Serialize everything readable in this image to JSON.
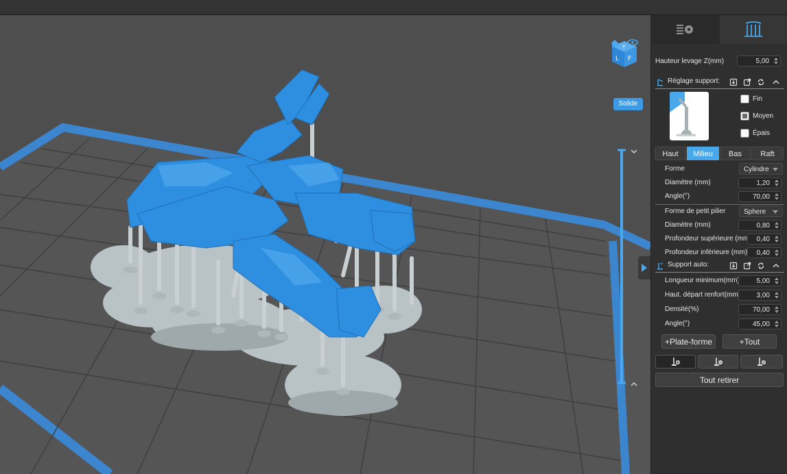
{
  "viewport": {
    "display_mode_label": "Solide"
  },
  "colors": {
    "accent": "#49a8ea",
    "model": "#2e8fe0",
    "support": "#b8c2c4"
  },
  "panel": {
    "lift_height": {
      "label": "Hauteur levage Z(mm)",
      "value": "5,00"
    },
    "support_settings": {
      "title": "Réglage support:",
      "options": [
        {
          "label": "Fin",
          "checked": false
        },
        {
          "label": "Moyen",
          "checked": true
        },
        {
          "label": "Épais",
          "checked": false
        }
      ],
      "tabs": [
        "Haut",
        "Milieu",
        "Bas",
        "Raft"
      ],
      "active_tab": "Milieu",
      "shape": {
        "label": "Forme",
        "value": "Cylindre"
      },
      "diameter": {
        "label": "Diamètre (mm)",
        "value": "1,20"
      },
      "angle": {
        "label": "Angle(°)",
        "value": "70,00"
      },
      "small_pillar_shape": {
        "label": "Forme de petit pilier",
        "value": "Sphere"
      },
      "small_diameter": {
        "label": "Diamètre (mm)",
        "value": "0,80"
      },
      "top_depth": {
        "label": "Profondeur supérieure (mm)",
        "value": "0,40"
      },
      "bottom_depth": {
        "label": "Profondeur inférieure (mm)",
        "value": "0,40"
      }
    },
    "auto_support": {
      "title": "Support auto:",
      "min_length": {
        "label": "Longueur minimum(mm)",
        "value": "5,00"
      },
      "brace_start": {
        "label": "Haut. départ renfort(mm)",
        "value": "3,00"
      },
      "density": {
        "label": "Densité(%)",
        "value": "70,00"
      },
      "angle": {
        "label": "Angle(°)",
        "value": "45,00"
      }
    },
    "buttons": {
      "platform": "+Plate-forme",
      "all": "+Tout",
      "remove_all": "Tout retirer"
    }
  }
}
